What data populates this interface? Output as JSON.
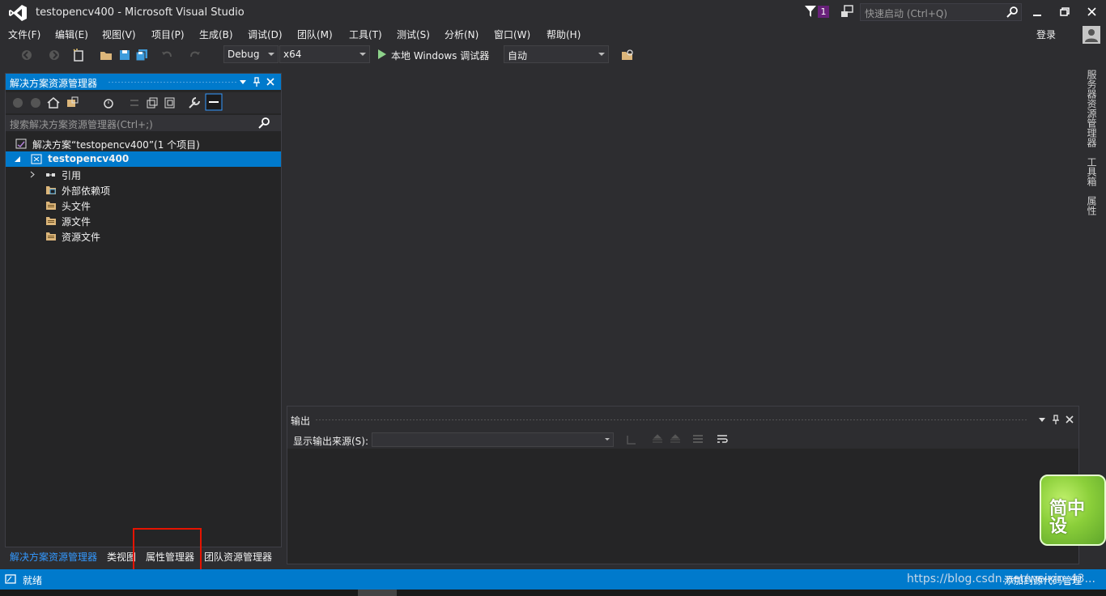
{
  "window": {
    "title": "testopencv400 - Microsoft Visual Studio",
    "notification_count": "1",
    "quick_launch_placeholder": "快速启动 (Ctrl+Q)",
    "sign_in": "登录"
  },
  "menu": [
    "文件(F)",
    "编辑(E)",
    "视图(V)",
    "项目(P)",
    "生成(B)",
    "调试(D)",
    "团队(M)",
    "工具(T)",
    "测试(S)",
    "分析(N)",
    "窗口(W)",
    "帮助(H)"
  ],
  "toolbar": {
    "config": "Debug",
    "platform": "x64",
    "run_label": "本地 Windows 调试器",
    "run_mode": "自动"
  },
  "solution_explorer": {
    "title": "解决方案资源管理器",
    "search_placeholder": "搜索解决方案资源管理器(Ctrl+;)",
    "tree": {
      "solution": "解决方案“testopencv400”(1 个项目)",
      "project": "testopencv400",
      "items": [
        "引用",
        "外部依赖项",
        "头文件",
        "源文件",
        "资源文件"
      ]
    }
  },
  "bottom_tabs": [
    "解决方案资源管理器",
    "类视图",
    "属性管理器",
    "团队资源管理器"
  ],
  "right_tabs": [
    "服务器资源管理器",
    "工具箱",
    "属性"
  ],
  "output": {
    "title": "输出",
    "source_label": "显示输出来源(S):",
    "source_value": ""
  },
  "status": {
    "text": "就绪",
    "watermark": "https://blog.csdn.net/weixin_43...",
    "source_control": "添加到源代码管理"
  },
  "ime": {
    "text": "简中设"
  },
  "colors": {
    "accent": "#007acc",
    "background": "#2d2d30",
    "panel": "#252526",
    "highlight_box": "#e51400"
  }
}
